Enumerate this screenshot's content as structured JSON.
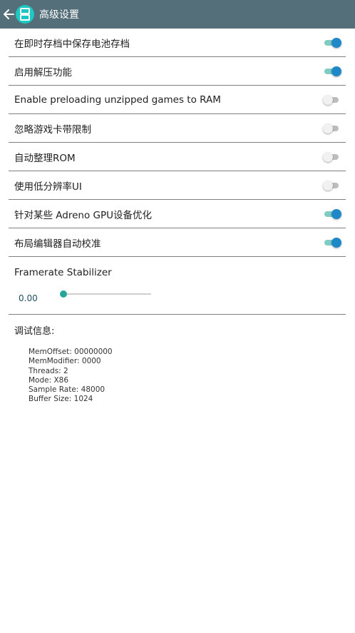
{
  "appbar": {
    "title": "高级设置",
    "logo_icon": "app-logo-icon",
    "back_icon": "arrow-left-icon"
  },
  "settings": [
    {
      "label": "在即时存档中保存电池存档",
      "on": true
    },
    {
      "label": "启用解压功能",
      "on": true
    },
    {
      "label": "Enable preloading unzipped games to RAM",
      "on": false
    },
    {
      "label": "忽略游戏卡带限制",
      "on": false
    },
    {
      "label": "自动整理ROM",
      "on": false
    },
    {
      "label": "使用低分辨率UI",
      "on": false
    },
    {
      "label": "针对某些 Adreno GPU设备优化",
      "on": true
    },
    {
      "label": "布局编辑器自动校准",
      "on": true
    }
  ],
  "framerate": {
    "label": "Framerate Stabilizer",
    "value": "0.00",
    "fraction": 0.0
  },
  "debug": {
    "title": "调试信息:",
    "lines": [
      "MemOffset: 00000000",
      "MemModifier: 0000",
      "Threads: 2",
      "Mode: X86",
      "Sample Rate: 48000",
      "Buffer Size: 1024"
    ]
  },
  "colors": {
    "appbar": "#546e7a",
    "accent": "#1e88c8",
    "logo": "#1ec8c2"
  }
}
